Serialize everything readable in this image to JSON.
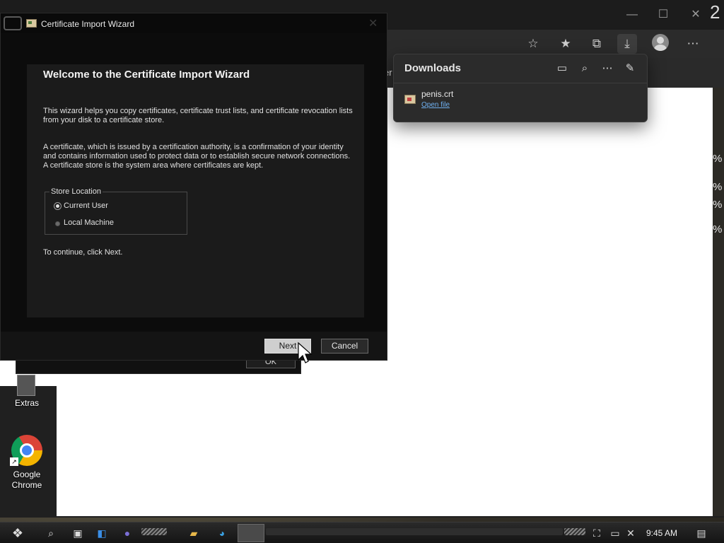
{
  "browser": {
    "tab_text": "vser",
    "window_controls": {
      "minimize": "—",
      "maximize": "☐",
      "close": "✕"
    },
    "toolbar_icons": [
      "add-favorite-icon",
      "favorites-icon",
      "collections-icon",
      "downloads-icon",
      "profile-icon",
      "more-icon"
    ],
    "side_percents": [
      "%",
      "%",
      "%",
      "%"
    ],
    "corner_digit": "2"
  },
  "downloads": {
    "title": "Downloads",
    "file": {
      "name": "penis.crt",
      "action": "Open file"
    }
  },
  "wizard": {
    "title": "Certificate Import Wizard",
    "heading": "Welcome to the Certificate Import Wizard",
    "para1": "This wizard helps you copy certificates, certificate trust lists, and certificate revocation lists from your disk to a certificate store.",
    "para2": "A certificate, which is issued by a certification authority, is a confirmation of your identity and contains information used to protect data or to establish secure network connections. A certificate store is the system area where certificates are kept.",
    "store_location": {
      "legend": "Store Location",
      "options": [
        {
          "label": "Current User",
          "selected": true
        },
        {
          "label": "Local Machine",
          "selected": false
        }
      ]
    },
    "continue_text": "To continue, click Next.",
    "next_label": "Next",
    "cancel_label": "Cancel"
  },
  "ok_dialog": {
    "ok_label": "OK"
  },
  "desktop": {
    "icons": [
      {
        "label": "Extras"
      },
      {
        "label": "Google Chrome"
      }
    ]
  },
  "taskbar": {
    "clock": "9:45 AM"
  }
}
